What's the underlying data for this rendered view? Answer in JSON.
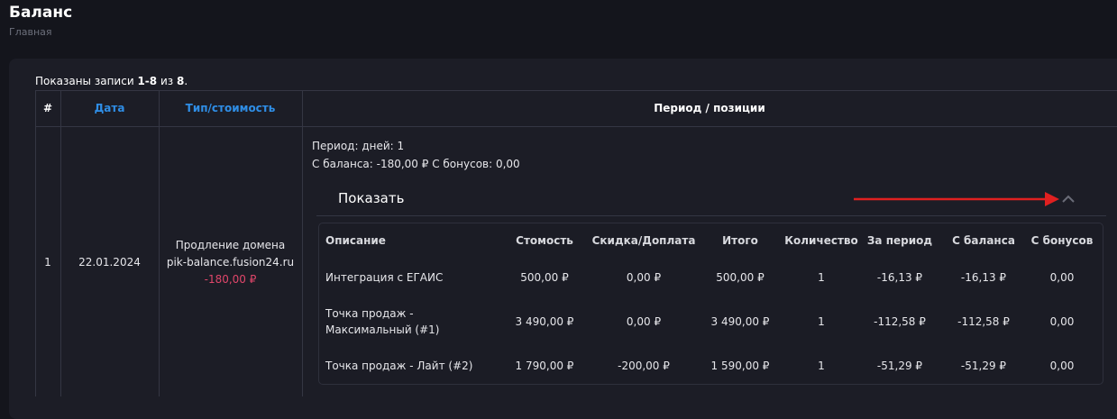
{
  "page": {
    "title": "Баланс",
    "breadcrumb": "Главная"
  },
  "summary": {
    "prefix": "Показаны записи",
    "range": "1-8",
    "of": "из",
    "total": "8",
    "suffix": "."
  },
  "table": {
    "headers": {
      "num": "#",
      "date": "Дата",
      "type": "Тип/стоимость",
      "period": "Период / позиции"
    },
    "row": {
      "num": "1",
      "date": "22.01.2024",
      "type_line1": "Продление домена",
      "type_line2": "pik-balance.fusion24.ru",
      "amount": "-180,00 ₽",
      "period_days": "Период: дней: 1",
      "period_balance": "С баланса: -180,00 ₽ С бонусов: 0,00",
      "toggle_label": "Показать"
    }
  },
  "positions": {
    "headers": [
      "Описание",
      "Стомость",
      "Скидка/Доплата",
      "Итого",
      "Количество",
      "За период",
      "С баланса",
      "С бонусов"
    ],
    "rows": [
      [
        "Интеграция с ЕГАИС",
        "500,00 ₽",
        "0,00 ₽",
        "500,00 ₽",
        "1",
        "-16,13 ₽",
        "-16,13 ₽",
        "0,00"
      ],
      [
        "Точка продаж - Максимальный (#1)",
        "3 490,00 ₽",
        "0,00 ₽",
        "3 490,00 ₽",
        "1",
        "-112,58 ₽",
        "-112,58 ₽",
        "0,00"
      ],
      [
        "Точка продаж - Лайт (#2)",
        "1 790,00 ₽",
        "-200,00 ₽",
        "1 590,00 ₽",
        "1",
        "-51,29 ₽",
        "-51,29 ₽",
        "0,00"
      ]
    ]
  },
  "colors": {
    "link": "#2f8ee6",
    "negative": "#e0466a",
    "annotation_arrow": "#e02020"
  },
  "icons": {
    "collapse": "chevron-up-icon",
    "annotation": "arrow-right-icon"
  }
}
